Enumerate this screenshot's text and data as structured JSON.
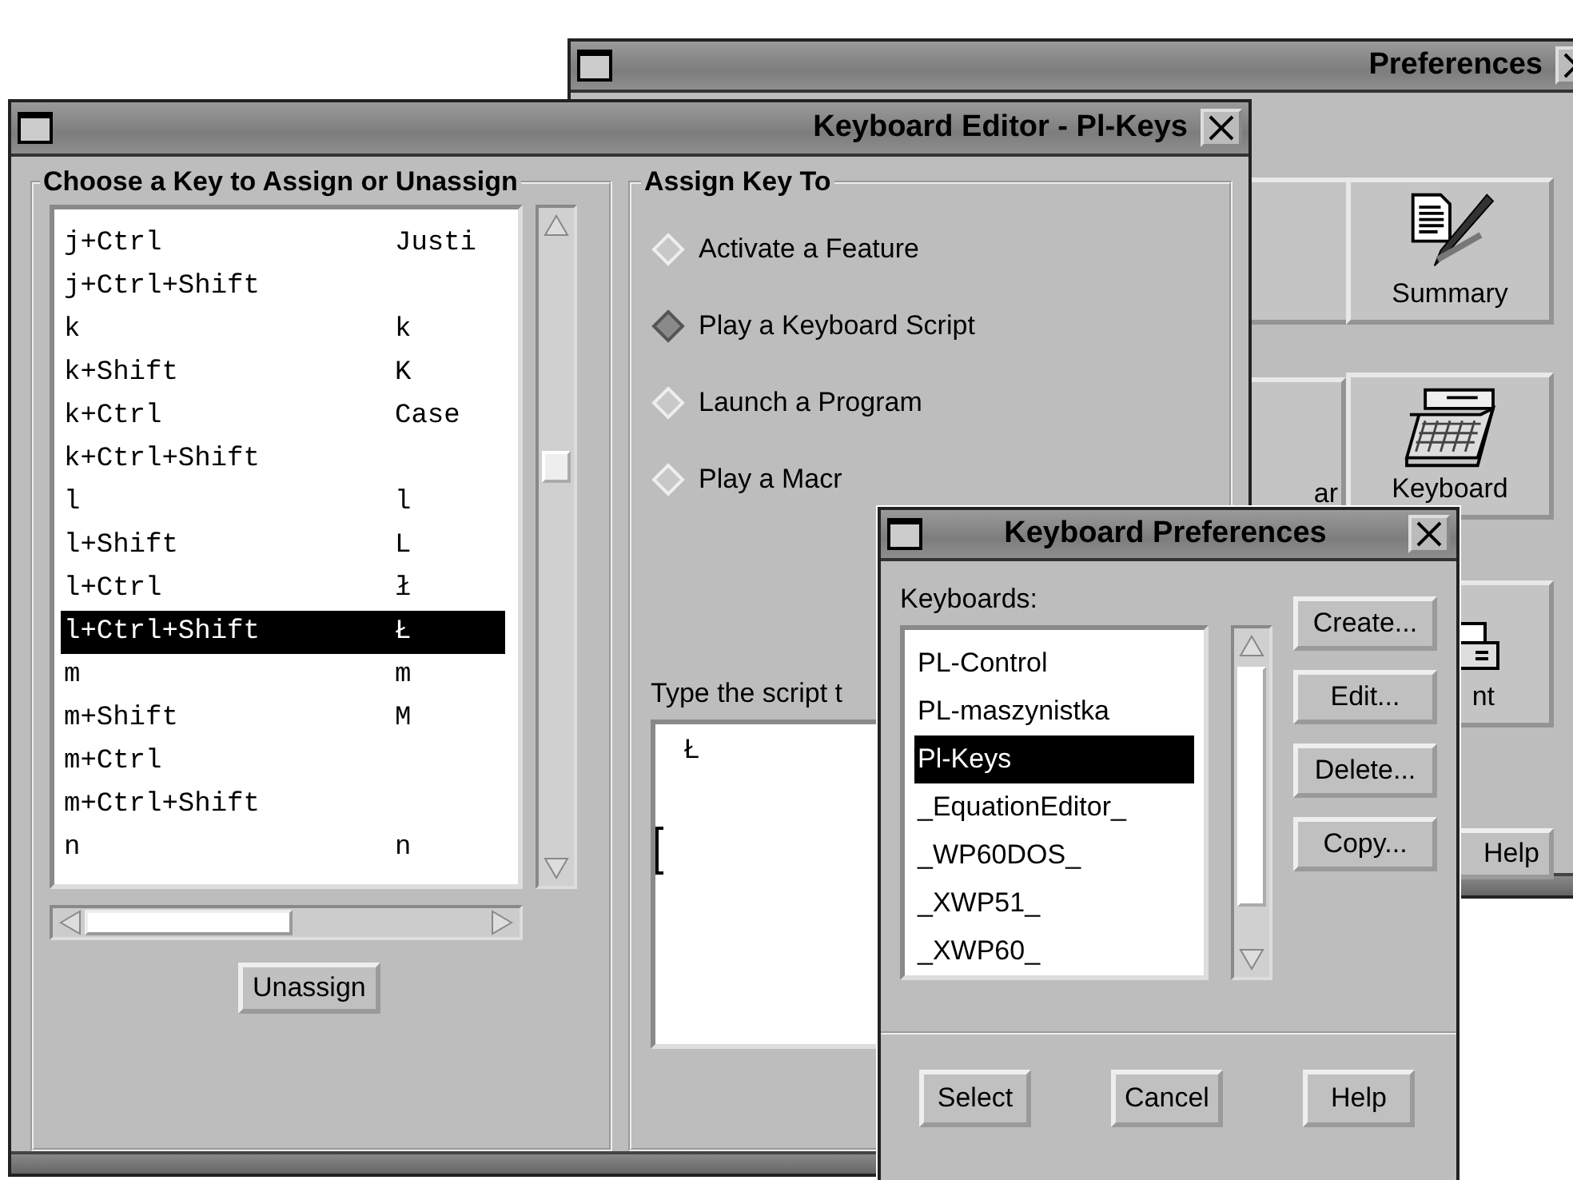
{
  "preferences_window": {
    "title": "Preferences",
    "buttons": [
      {
        "label": "Summary",
        "kind": "summary"
      },
      {
        "label": "ar",
        "kind": "plain"
      },
      {
        "label": "Keyboard",
        "kind": "keyboard"
      },
      {
        "label": "nt",
        "kind": "printer"
      }
    ],
    "help_button": "Help"
  },
  "editor_window": {
    "title": "Keyboard Editor - Pl-Keys",
    "key_group": {
      "title": "Choose a Key to Assign or Unassign",
      "rows": [
        {
          "key": "j+Ctrl",
          "value": "Justi",
          "selected": false
        },
        {
          "key": "j+Ctrl+Shift",
          "selected": false
        },
        {
          "key": "k",
          "value": "k",
          "selected": false
        },
        {
          "key": "k+Shift",
          "value": "K",
          "selected": false
        },
        {
          "key": "k+Ctrl",
          "value": "Case",
          "selected": false
        },
        {
          "key": "k+Ctrl+Shift",
          "selected": false
        },
        {
          "key": "l",
          "value": "l",
          "selected": false
        },
        {
          "key": "l+Shift",
          "value": "L",
          "selected": false
        },
        {
          "key": "l+Ctrl",
          "value": "ł",
          "selected": false
        },
        {
          "key": "l+Ctrl+Shift",
          "value": "Ł",
          "selected": true
        },
        {
          "key": "m",
          "value": "m",
          "selected": false
        },
        {
          "key": "m+Shift",
          "value": "M",
          "selected": false
        },
        {
          "key": "m+Ctrl",
          "selected": false
        },
        {
          "key": "m+Ctrl+Shift",
          "selected": false
        },
        {
          "key": "n",
          "value": "n",
          "selected": false
        }
      ],
      "unassign_button": "Unassign"
    },
    "assign_group": {
      "title": "Assign Key To",
      "options": [
        {
          "label": "Activate a Feature",
          "selected": false
        },
        {
          "label": "Play a Keyboard Script",
          "selected": true
        },
        {
          "label": "Launch a Program",
          "selected": false
        },
        {
          "label": "Play a Macr",
          "selected": false
        }
      ],
      "script_label": "Type the script t",
      "script_value": "Ł"
    }
  },
  "keyboard_preferences_window": {
    "title": "Keyboard Preferences",
    "list_label": "Keyboards:",
    "keyboards": [
      {
        "name": "PL-Control",
        "selected": false
      },
      {
        "name": "PL-maszynistka",
        "selected": false
      },
      {
        "name": "Pl-Keys",
        "selected": true
      },
      {
        "name": "_EquationEditor_",
        "selected": false
      },
      {
        "name": "_WP60DOS_",
        "selected": false
      },
      {
        "name": "_XWP51_",
        "selected": false
      },
      {
        "name": "_XWP60_",
        "selected": false
      }
    ],
    "side_buttons": [
      "Create...",
      "Edit...",
      "Delete...",
      "Copy..."
    ],
    "bottom_buttons": [
      "Select",
      "Cancel",
      "Help"
    ]
  }
}
